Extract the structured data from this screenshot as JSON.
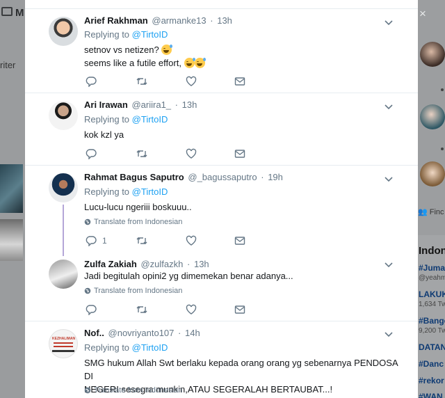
{
  "background": {
    "left_header": "M",
    "left_partial_text": "riter",
    "right_close_glyph": "×",
    "right_find": "Finc",
    "trends": [
      {
        "text": "Indon",
        "kind": "heading"
      },
      {
        "text": "#Juma",
        "kind": "tag"
      },
      {
        "text": "@yeahm",
        "kind": "sub"
      },
      {
        "text": "LAKUK",
        "kind": "tag"
      },
      {
        "text": "1,634 Tw",
        "kind": "sub"
      },
      {
        "text": "#Bango",
        "kind": "tag"
      },
      {
        "text": "9,200 Tw",
        "kind": "sub"
      },
      {
        "text": "DATAN",
        "kind": "tag"
      },
      {
        "text": "#Danc",
        "kind": "tag"
      },
      {
        "text": "#rekor",
        "kind": "tag"
      },
      {
        "text": "#WAN",
        "kind": "tag"
      }
    ]
  },
  "icons": {
    "reply": "reply-icon",
    "retweet": "retweet-icon",
    "like": "heart-icon",
    "dm": "envelope-icon",
    "more": "chevron-down-icon",
    "globe": "globe-icon"
  },
  "colors": {
    "link": "#1da1f2",
    "muted": "#657786",
    "thread": "#b4a6d8"
  },
  "tweets": [
    {
      "name": "Arief Rakhman",
      "handle": "@armanke13",
      "time": "13h",
      "replying_prefix": "Replying to",
      "replying_to": "@TirtoID",
      "text_line1": "setnov vs netizen?",
      "text_line2": "seems like a futile effort,",
      "emoji": "grinning-sweat"
    },
    {
      "name": "Ari Irawan",
      "handle": "@ariira1_",
      "time": "13h",
      "replying_prefix": "Replying to",
      "replying_to": "@TirtoID",
      "text": "kok kzl ya"
    },
    {
      "name": "Rahmat Bagus Saputro",
      "handle": "@_bagussaputro",
      "time": "19h",
      "replying_prefix": "Replying to",
      "replying_to": "@TirtoID",
      "text": "Lucu-lucu ngeriii boskuuu..",
      "translate": "Translate from Indonesian",
      "reply_count": "1"
    },
    {
      "name": "Zulfa Zakiah",
      "handle": "@zulfazkh",
      "time": "13h",
      "text": "Jadi begitulah opini2 yg dimemekan benar adanya...",
      "translate": "Translate from Indonesian"
    },
    {
      "name": "Nof..",
      "handle": "@novriyanto107",
      "time": "14h",
      "replying_prefix": "Replying to",
      "replying_to": "@TirtoID",
      "text_line1": "SMG hukum Allah Swt berlaku kepada orang orang yg sebenarnya PENDOSA DI",
      "text_line2": "NEGERI sesegra munkin,ATAU SEGERALAH BERTAUBAT...!",
      "translate": "Translate from Indonesian",
      "avatar_text": "KEZHALIMAN"
    }
  ],
  "separator": "·"
}
